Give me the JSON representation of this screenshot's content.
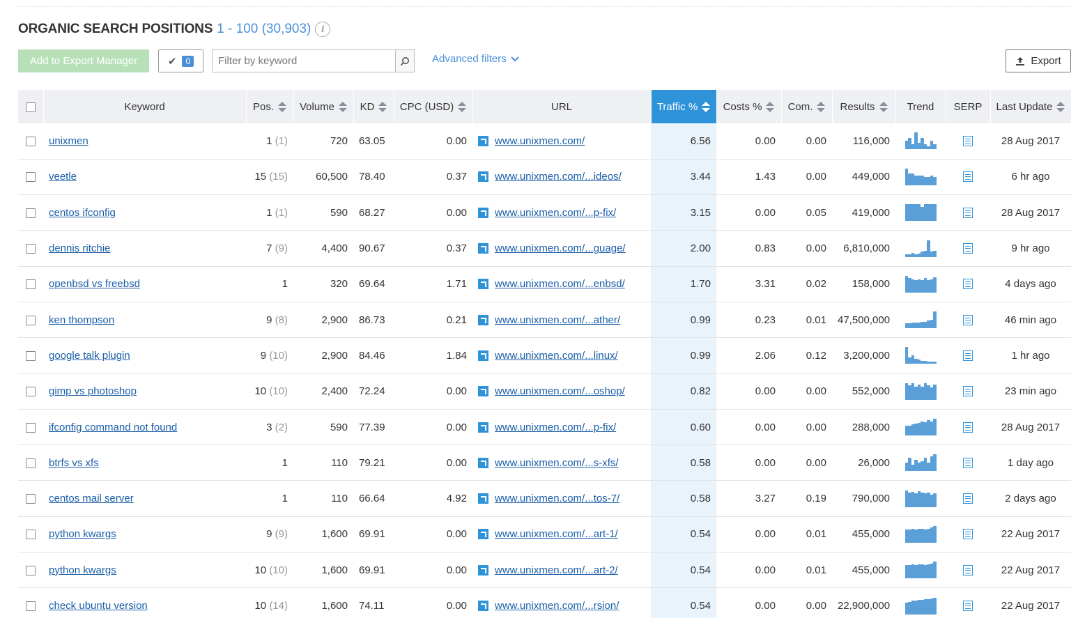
{
  "header": {
    "title": "ORGANIC SEARCH POSITIONS",
    "range": "1 - 100 (30,903)",
    "info_icon": "i"
  },
  "toolbar": {
    "export_manager_label": "Add to Export Manager",
    "selected_count": "0",
    "filter_placeholder": "Filter by keyword",
    "advanced_filters_label": "Advanced filters",
    "export_label": "Export"
  },
  "columns": {
    "keyword": "Keyword",
    "pos": "Pos.",
    "volume": "Volume",
    "kd": "KD",
    "cpc": "CPC (USD)",
    "url": "URL",
    "traffic": "Traffic %",
    "costs": "Costs %",
    "com": "Com.",
    "results": "Results",
    "trend": "Trend",
    "serp": "SERP",
    "last_update": "Last Update"
  },
  "rows": [
    {
      "keyword": "unixmen",
      "pos": "1",
      "prev": "(1)",
      "volume": "720",
      "kd": "63.05",
      "cpc": "0.00",
      "url": "www.unixmen.com/",
      "traffic": "6.56",
      "costs": "0.00",
      "com": "0.00",
      "results": "116,000",
      "last": "28 Aug 2017",
      "trend": [
        0.5,
        0.7,
        0.3,
        1,
        0.4,
        0.7,
        0.3,
        0.2,
        0.5,
        0.3
      ]
    },
    {
      "keyword": "veetle",
      "pos": "15",
      "prev": "(15)",
      "volume": "60,500",
      "kd": "78.40",
      "cpc": "0.37",
      "url": "www.unixmen.com/...ideos/",
      "traffic": "3.44",
      "costs": "1.43",
      "com": "0.00",
      "results": "449,000",
      "last": "6 hr ago",
      "trend": [
        1,
        0.7,
        0.7,
        0.6,
        0.6,
        0.6,
        0.5,
        0.5,
        0.6,
        0.5
      ]
    },
    {
      "keyword": "centos ifconfig",
      "pos": "1",
      "prev": "(1)",
      "volume": "590",
      "kd": "68.27",
      "cpc": "0.00",
      "url": "www.unixmen.com/...p-fix/",
      "traffic": "3.15",
      "costs": "0.00",
      "com": "0.05",
      "results": "419,000",
      "last": "28 Aug 2017",
      "trend": [
        1,
        1,
        1,
        1,
        1,
        0.85,
        1,
        1,
        1,
        1
      ]
    },
    {
      "keyword": "dennis ritchie",
      "pos": "7",
      "prev": "(9)",
      "volume": "4,400",
      "kd": "90.67",
      "cpc": "0.37",
      "url": "www.unixmen.com/...guage/",
      "traffic": "2.00",
      "costs": "0.83",
      "com": "0.00",
      "results": "6,810,000",
      "last": "9 hr ago",
      "trend": [
        0.15,
        0.15,
        0.25,
        0.15,
        0.2,
        0.3,
        0.35,
        1,
        0.3,
        0.35
      ]
    },
    {
      "keyword": "openbsd vs freebsd",
      "pos": "1",
      "prev": "",
      "volume": "320",
      "kd": "69.64",
      "cpc": "1.71",
      "url": "www.unixmen.com/...enbsd/",
      "traffic": "1.70",
      "costs": "3.31",
      "com": "0.02",
      "results": "158,000",
      "last": "4 days ago",
      "trend": [
        1,
        0.85,
        0.8,
        0.75,
        0.8,
        0.75,
        0.85,
        0.75,
        0.8,
        0.9
      ]
    },
    {
      "keyword": "ken thompson",
      "pos": "9",
      "prev": "(8)",
      "volume": "2,900",
      "kd": "86.73",
      "cpc": "0.21",
      "url": "www.unixmen.com/...ather/",
      "traffic": "0.99",
      "costs": "0.23",
      "com": "0.01",
      "results": "47,500,000",
      "last": "46 min ago",
      "trend": [
        0.3,
        0.3,
        0.35,
        0.35,
        0.35,
        0.4,
        0.4,
        0.45,
        0.5,
        1
      ]
    },
    {
      "keyword": "google talk plugin",
      "pos": "9",
      "prev": "(10)",
      "volume": "2,900",
      "kd": "84.46",
      "cpc": "1.84",
      "url": "www.unixmen.com/...linux/",
      "traffic": "0.99",
      "costs": "2.06",
      "com": "0.12",
      "results": "3,200,000",
      "last": "1 hr ago",
      "trend": [
        1,
        0.4,
        0.5,
        0.3,
        0.25,
        0.2,
        0.2,
        0.15,
        0.15,
        0.15
      ]
    },
    {
      "keyword": "gimp vs photoshop",
      "pos": "10",
      "prev": "(10)",
      "volume": "2,400",
      "kd": "72.24",
      "cpc": "0.00",
      "url": "www.unixmen.com/...oshop/",
      "traffic": "0.82",
      "costs": "0.00",
      "com": "0.00",
      "results": "552,000",
      "last": "23 min ago",
      "trend": [
        1,
        0.85,
        1,
        0.8,
        0.9,
        0.8,
        1,
        0.85,
        0.75,
        0.9
      ]
    },
    {
      "keyword": "ifconfig command not found",
      "pos": "3",
      "prev": "(2)",
      "volume": "590",
      "kd": "77.39",
      "cpc": "0.00",
      "url": "www.unixmen.com/...p-fix/",
      "traffic": "0.60",
      "costs": "0.00",
      "com": "0.00",
      "results": "288,000",
      "last": "28 Aug 2017",
      "trend": [
        0.6,
        0.6,
        0.65,
        0.7,
        0.75,
        0.85,
        0.8,
        0.9,
        0.85,
        1
      ]
    },
    {
      "keyword": "btrfs vs xfs",
      "pos": "1",
      "prev": "",
      "volume": "110",
      "kd": "79.21",
      "cpc": "0.00",
      "url": "www.unixmen.com/...s-xfs/",
      "traffic": "0.58",
      "costs": "0.00",
      "com": "0.00",
      "results": "26,000",
      "last": "1 day ago",
      "trend": [
        0.5,
        0.8,
        0.4,
        0.7,
        0.5,
        0.6,
        0.8,
        0.5,
        0.9,
        1
      ]
    },
    {
      "keyword": "centos mail server",
      "pos": "1",
      "prev": "",
      "volume": "110",
      "kd": "66.64",
      "cpc": "4.92",
      "url": "www.unixmen.com/...tos-7/",
      "traffic": "0.58",
      "costs": "3.27",
      "com": "0.19",
      "results": "790,000",
      "last": "2 days ago",
      "trend": [
        1,
        0.85,
        0.9,
        0.8,
        0.95,
        0.85,
        0.8,
        0.85,
        0.75,
        0.8
      ]
    },
    {
      "keyword": "python kwargs",
      "pos": "9",
      "prev": "(9)",
      "volume": "1,600",
      "kd": "69.91",
      "cpc": "0.00",
      "url": "www.unixmen.com/...art-1/",
      "traffic": "0.54",
      "costs": "0.00",
      "com": "0.01",
      "results": "455,000",
      "last": "22 Aug 2017",
      "trend": [
        0.8,
        0.8,
        0.85,
        0.8,
        0.85,
        0.85,
        0.8,
        0.85,
        0.9,
        1
      ]
    },
    {
      "keyword": "python kwargs",
      "pos": "10",
      "prev": "(10)",
      "volume": "1,600",
      "kd": "69.91",
      "cpc": "0.00",
      "url": "www.unixmen.com/...art-2/",
      "traffic": "0.54",
      "costs": "0.00",
      "com": "0.01",
      "results": "455,000",
      "last": "22 Aug 2017",
      "trend": [
        0.8,
        0.8,
        0.85,
        0.8,
        0.85,
        0.85,
        0.8,
        0.85,
        0.9,
        1
      ]
    },
    {
      "keyword": "check ubuntu version",
      "pos": "10",
      "prev": "(14)",
      "volume": "1,600",
      "kd": "74.11",
      "cpc": "0.00",
      "url": "www.unixmen.com/...rsion/",
      "traffic": "0.54",
      "costs": "0.00",
      "com": "0.00",
      "results": "22,900,000",
      "last": "22 Aug 2017",
      "trend": [
        0.7,
        0.75,
        0.8,
        0.8,
        0.85,
        0.85,
        0.9,
        0.9,
        0.95,
        1
      ]
    }
  ]
}
